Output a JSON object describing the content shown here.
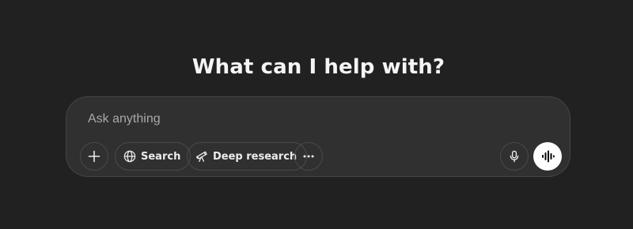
{
  "headline": "What can I help with?",
  "composer": {
    "placeholder": "Ask anything",
    "value": "",
    "tools": {
      "attach_icon": "plus-icon",
      "search_label": "Search",
      "search_icon": "globe-icon",
      "deep_research_label": "Deep research",
      "deep_research_icon": "telescope-icon",
      "more_icon": "ellipsis-icon"
    },
    "dictate_icon": "microphone-icon",
    "voice_icon": "waveform-icon"
  },
  "colors": {
    "background": "#212121",
    "composer_background": "#303030",
    "composer_border": "#454545",
    "text": "#ececec",
    "placeholder": "#a8a8a8",
    "voice_button": "#ffffff"
  }
}
